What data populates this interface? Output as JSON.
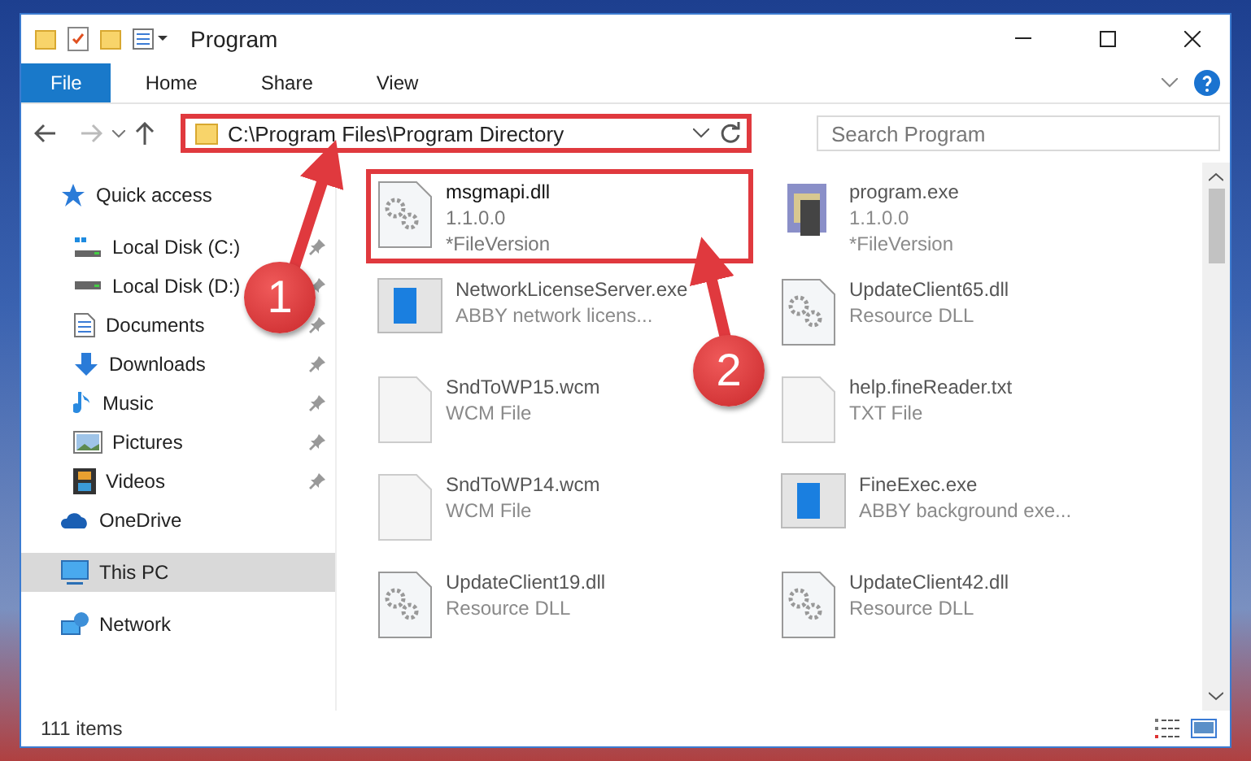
{
  "window": {
    "title": "Program"
  },
  "ribbon": {
    "tabs": [
      {
        "label": "File",
        "kind": "file"
      },
      {
        "label": "Home",
        "kind": "tab"
      },
      {
        "label": "Share",
        "kind": "tab"
      },
      {
        "label": "View",
        "kind": "tab"
      }
    ]
  },
  "address": {
    "path": "C:\\Program Files\\Program Directory",
    "highlighted": true
  },
  "search": {
    "placeholder": "Search Program"
  },
  "sidebar": {
    "items": [
      {
        "label": "Quick access",
        "selected": false,
        "children": [
          {
            "label": "Local Disk (C:)",
            "pinned": true,
            "selected": false
          },
          {
            "label": "Local Disk (D:)",
            "pinned": true,
            "selected": false
          },
          {
            "label": "Documents",
            "pinned": true,
            "selected": false
          },
          {
            "label": "Downloads",
            "pinned": true,
            "selected": false
          },
          {
            "label": "Music",
            "pinned": true,
            "selected": false
          },
          {
            "label": "Pictures",
            "pinned": true,
            "selected": false
          },
          {
            "label": "Videos",
            "pinned": true,
            "selected": false
          }
        ]
      },
      {
        "label": "OneDrive",
        "selected": false
      },
      {
        "label": "This PC",
        "selected": true
      },
      {
        "label": "Network",
        "selected": false
      }
    ]
  },
  "files": [
    {
      "name": "msgmapi.dll",
      "line_1": "1.1.0.0",
      "line_2": "*FileVersion",
      "highlighted": true
    },
    {
      "name": "program.exe",
      "line_1": "1.1.0.0",
      "line_2": "*FileVersion",
      "highlighted": false
    },
    {
      "name": "NetworkLicenseServer.exe",
      "line_1": "ABBY network licens...",
      "highlighted": false
    },
    {
      "name": "UpdateClient65.dll",
      "line_1": "Resource DLL",
      "highlighted": false
    },
    {
      "name": "SndToWP15.wcm",
      "line_1": "WCM File",
      "highlighted": false
    },
    {
      "name": "help.fineReader.txt",
      "line_1": "TXT File",
      "highlighted": false
    },
    {
      "name": "SndToWP14.wcm",
      "line_1": "WCM File",
      "highlighted": false
    },
    {
      "name": "FineExec.exe",
      "line_1": "ABBY background exe...",
      "highlighted": false
    },
    {
      "name": "UpdateClient19.dll",
      "line_1": "Resource DLL",
      "highlighted": false
    },
    {
      "name": "UpdateClient42.dll",
      "line_1": "Resource DLL",
      "highlighted": false
    }
  ],
  "status_bar": {
    "count": "111 items"
  },
  "annotations": [
    {
      "number": "1"
    },
    {
      "number": "2"
    }
  ]
}
